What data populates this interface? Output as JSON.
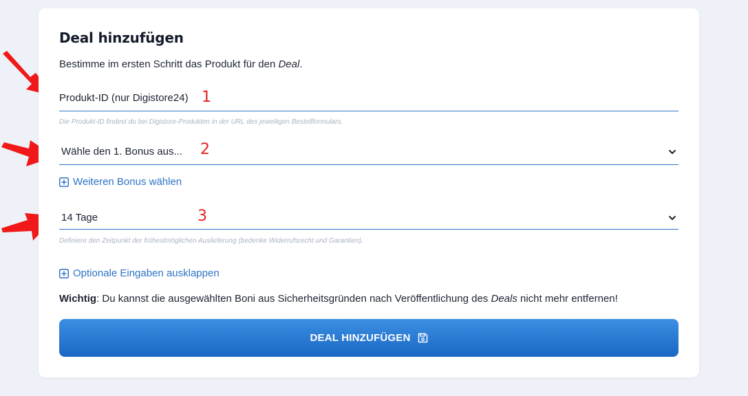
{
  "form": {
    "title": "Deal hinzufügen",
    "intro_prefix": "Bestimme im ersten Schritt das Produkt für den ",
    "intro_em": "Deal",
    "intro_suffix": ".",
    "product_field": {
      "label": "Produkt-ID (nur Digistore24)",
      "hint": "Die Produkt-ID findest du bei Digistore-Produkten in der URL des jeweiligen Bestellformulars."
    },
    "bonus_select": {
      "selected": "Wähle den 1. Bonus aus..."
    },
    "add_bonus_label": "Weiteren Bonus wählen",
    "delivery_select": {
      "selected": "14 Tage",
      "hint": "Definiere den Zeitpunkt der frühestmöglichen Auslieferung (bedenke Widerrufsrecht und Garantien)."
    },
    "optional_label": "Optionale Eingaben ausklappen",
    "warning": {
      "strong": "Wichtig",
      "text_a": ": Du kannst die ausgewählten Boni aus Sicherheitsgründen nach Veröffentlichung des ",
      "em": "Deals",
      "text_b": " nicht mehr entfernen!"
    },
    "submit_label": "DEAL HINZUFÜGEN"
  },
  "annotations": [
    "1",
    "2",
    "3"
  ],
  "icons": {
    "chevron": "chevron-down-icon",
    "expand": "plus-square-icon",
    "save": "floppy-disk-icon",
    "annotation_arrow": "red-arrow-icon"
  },
  "colors": {
    "accent": "#2d73c4",
    "button_top": "#3b8fe3",
    "button_bottom": "#1a67c3",
    "annotation": "#e32222",
    "background": "#eef1f7"
  }
}
